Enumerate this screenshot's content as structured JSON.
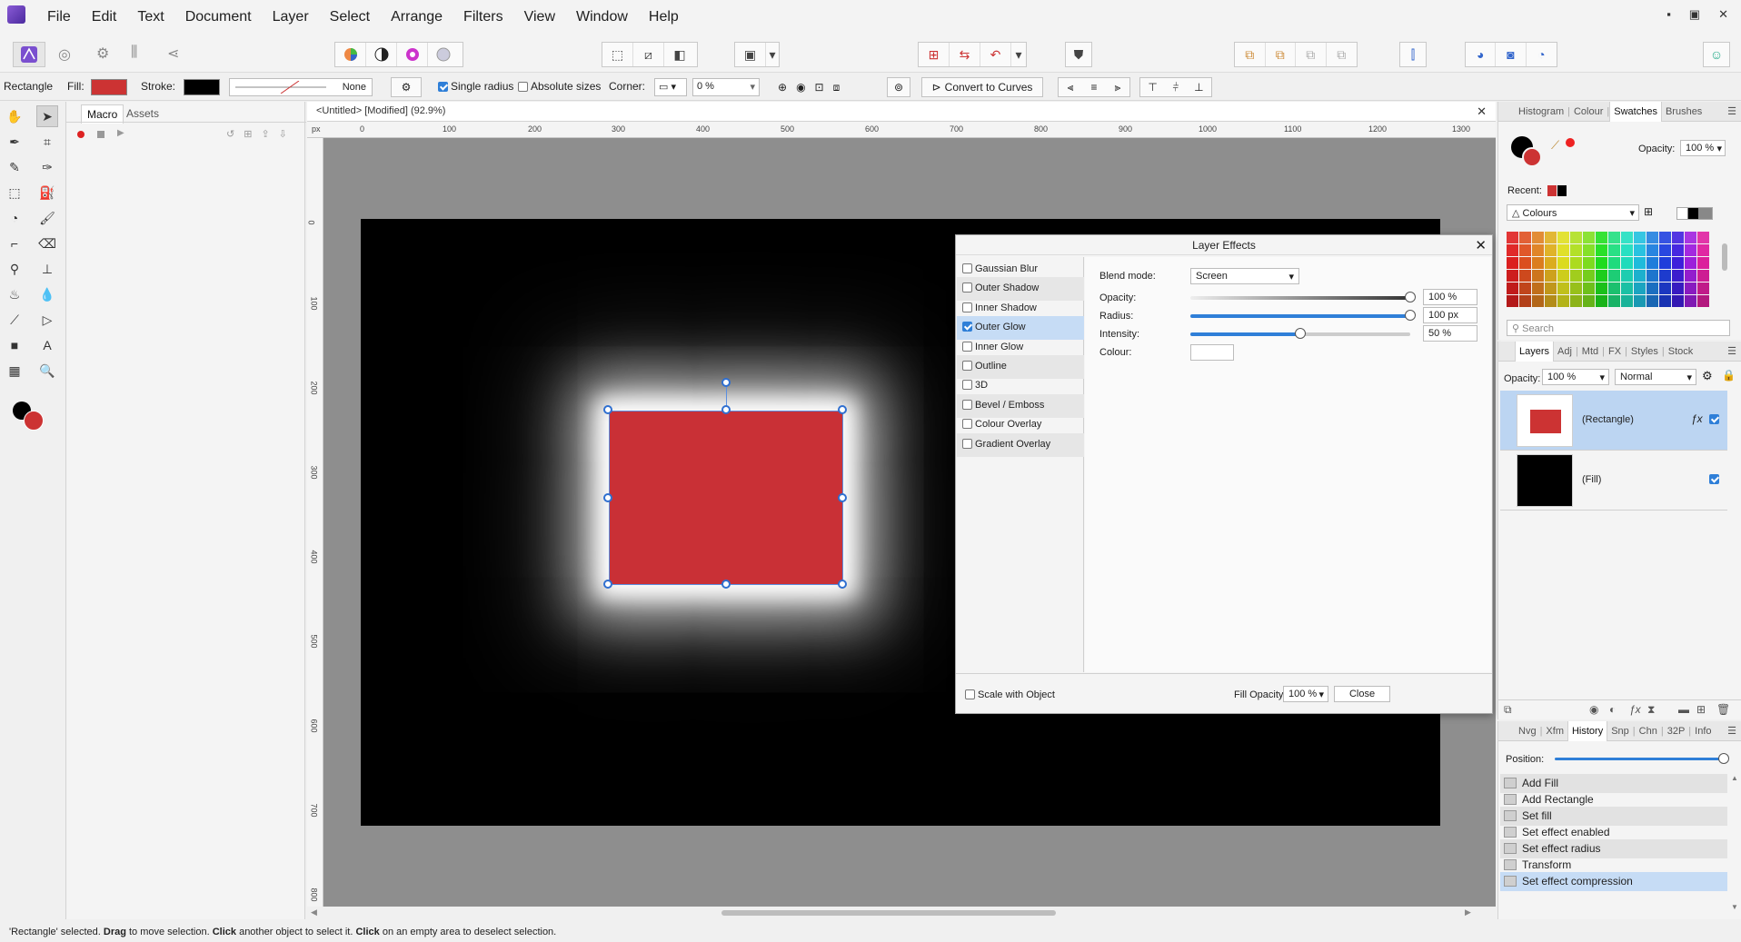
{
  "menu": [
    "File",
    "Edit",
    "Text",
    "Document",
    "Layer",
    "Select",
    "Arrange",
    "Filters",
    "View",
    "Window",
    "Help"
  ],
  "window_controls": [
    "▪",
    "▣",
    "✕"
  ],
  "context": {
    "tool_name": "Rectangle",
    "fill_label": "Fill:",
    "stroke_label": "Stroke:",
    "stroke_style": "None",
    "single_radius": "Single radius",
    "absolute_sizes": "Absolute sizes",
    "corner_label": "Corner:",
    "corner_value": "0 %",
    "convert_label": "Convert to Curves",
    "fill_color": "#cc3333",
    "stroke_color": "#000000"
  },
  "left_panel": {
    "tabs": [
      "Macro",
      "Assets"
    ]
  },
  "document": {
    "title": "<Untitled> [Modified] (92.9%)",
    "ruler_units": "px",
    "ruler_top": [
      "0",
      "100",
      "200",
      "300",
      "400",
      "500",
      "600",
      "700",
      "800",
      "900",
      "1000",
      "1100",
      "1200",
      "1300"
    ],
    "ruler_left": [
      "0",
      "100",
      "200",
      "300",
      "400",
      "500",
      "600",
      "700",
      "800"
    ]
  },
  "fx_dialog": {
    "title": "Layer Effects",
    "effects": [
      {
        "label": "Gaussian Blur",
        "checked": false
      },
      {
        "label": "Outer Shadow",
        "checked": false
      },
      {
        "label": "Inner Shadow",
        "checked": false
      },
      {
        "label": "Outer Glow",
        "checked": true
      },
      {
        "label": "Inner Glow",
        "checked": false
      },
      {
        "label": "Outline",
        "checked": false
      },
      {
        "label": "3D",
        "checked": false
      },
      {
        "label": "Bevel / Emboss",
        "checked": false
      },
      {
        "label": "Colour Overlay",
        "checked": false
      },
      {
        "label": "Gradient Overlay",
        "checked": false
      }
    ],
    "blend_mode_label": "Blend mode:",
    "blend_mode": "Screen",
    "opacity_label": "Opacity:",
    "opacity": "100 %",
    "opacity_level": 1.0,
    "radius_label": "Radius:",
    "radius": "100 px",
    "radius_level": 1.0,
    "intensity_label": "Intensity:",
    "intensity": "50 %",
    "intensity_level": 0.5,
    "colour_label": "Colour:",
    "scale_label": "Scale with Object",
    "fill_opacity_label": "Fill Opacity:",
    "fill_opacity": "100 %",
    "close_label": "Close"
  },
  "swatches_panel": {
    "tabs": [
      "Histogram",
      "Colour",
      "Swatches",
      "Brushes"
    ],
    "opacity_label": "Opacity:",
    "opacity": "100 %",
    "recent_label": "Recent:",
    "palette": "Colours",
    "search_placeholder": "Search"
  },
  "layers_panel": {
    "tabs": [
      "Layers",
      "Adj",
      "Mtd",
      "FX",
      "Styles",
      "Stock"
    ],
    "opacity_label": "Opacity:",
    "opacity": "100 %",
    "blend": "Normal",
    "layers": [
      {
        "name": "(Rectangle)",
        "selected": true
      },
      {
        "name": "(Fill)",
        "selected": false
      }
    ]
  },
  "history_panel": {
    "tabs": [
      "Nvg",
      "Xfm",
      "History",
      "Snp",
      "Chn",
      "32P",
      "Info"
    ],
    "position_label": "Position:",
    "items": [
      "Add Fill",
      "Add Rectangle",
      "Set fill",
      "Set effect enabled",
      "Set effect radius",
      "Transform",
      "Set effect compression"
    ]
  },
  "status": {
    "p1": "'Rectangle' selected. ",
    "b1": "Drag",
    "p2": " to move selection. ",
    "b2": "Click",
    "p3": " another object to select it. ",
    "b3": "Click",
    "p4": " on an empty area to deselect selection."
  }
}
